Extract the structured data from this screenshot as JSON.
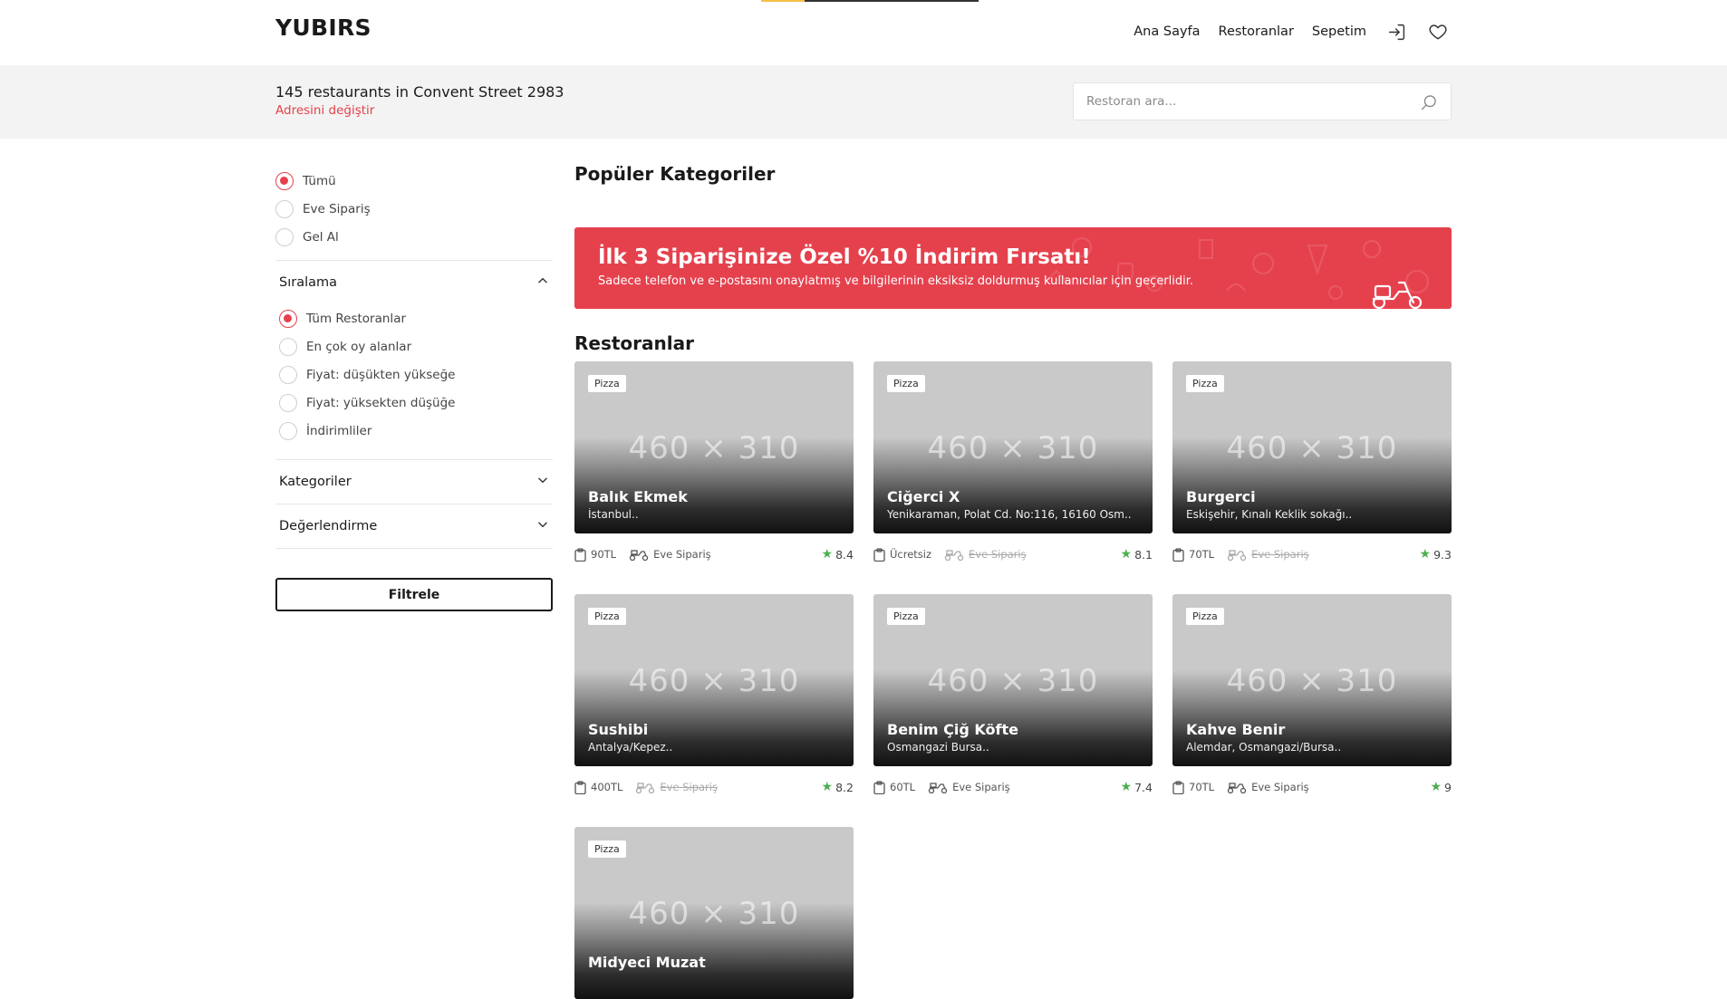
{
  "header": {
    "logo": "YUBIRS",
    "nav": [
      {
        "label": "Ana Sayfa"
      },
      {
        "label": "Restoranlar"
      },
      {
        "label": "Sepetim"
      }
    ],
    "login_icon": "login-icon",
    "favorites_icon": "heart-icon"
  },
  "subbar": {
    "count_text": "145 restaurants in Convent Street 2983",
    "change_link": "Adresini değiştir",
    "search_placeholder": "Restoran ara..."
  },
  "sidebar": {
    "type_options": [
      {
        "label": "Tümü",
        "selected": true
      },
      {
        "label": "Eve Sipariş",
        "selected": false
      },
      {
        "label": "Gel Al",
        "selected": false
      }
    ],
    "sort": {
      "title": "Sıralama",
      "options": [
        {
          "label": "Tüm Restoranlar",
          "selected": true
        },
        {
          "label": "En çok oy alanlar",
          "selected": false
        },
        {
          "label": "Fiyat: düşükten yükseğe",
          "selected": false
        },
        {
          "label": "Fiyat: yüksekten düşüğe",
          "selected": false
        },
        {
          "label": "İndirimliler",
          "selected": false
        }
      ]
    },
    "categories_title": "Kategoriler",
    "rating_title": "Değerlendirme",
    "filter_button": "Filtrele"
  },
  "main": {
    "popular_title": "Popüler Kategoriler",
    "banner": {
      "title": "İlk 3 Siparişinize Özel %10 İndirim Fırsatı!",
      "subtitle": "Sadece telefon ve e-postasını onaylatmış ve bilgilerinin eksiksiz doldurmuş kullanıcılar için geçerlidir."
    },
    "restaurants_title": "Restoranlar",
    "placeholder_text": "460 × 310",
    "restaurants": [
      {
        "tag": "Pizza",
        "name": "Balık Ekmek",
        "address": "İstanbul..",
        "price": "90TL",
        "delivery": "Eve Sipariş",
        "delivery_available": true,
        "rating": "8.4"
      },
      {
        "tag": "Pizza",
        "name": "Ciğerci X",
        "address": "Yenikaraman, Polat Cd. No:116, 16160 Osm..",
        "price": "Ücretsiz",
        "delivery": "Eve Sipariş",
        "delivery_available": false,
        "rating": "8.1"
      },
      {
        "tag": "Pizza",
        "name": "Burgerci",
        "address": "Eskişehir, Kınalı Keklik sokağı..",
        "price": "70TL",
        "delivery": "Eve Sipariş",
        "delivery_available": false,
        "rating": "9.3"
      },
      {
        "tag": "Pizza",
        "name": "Sushibi",
        "address": "Antalya/Kepez..",
        "price": "400TL",
        "delivery": "Eve Sipariş",
        "delivery_available": false,
        "rating": "8.2"
      },
      {
        "tag": "Pizza",
        "name": "Benim Çiğ Köfte",
        "address": "Osmangazi Bursa..",
        "price": "60TL",
        "delivery": "Eve Sipariş",
        "delivery_available": true,
        "rating": "7.4"
      },
      {
        "tag": "Pizza",
        "name": "Kahve Benir",
        "address": "Alemdar, Osmangazi/Bursa..",
        "price": "70TL",
        "delivery": "Eve Sipariş",
        "delivery_available": true,
        "rating": "9"
      },
      {
        "tag": "Pizza",
        "name": "Midyeci Muzat",
        "address": "",
        "price": "",
        "delivery": "",
        "delivery_available": false,
        "rating": ""
      }
    ]
  },
  "colors": {
    "accent": "#e5414d",
    "rating_star": "#4caf50",
    "subbar_bg": "#f3f3f3",
    "progress": "#f5c048"
  }
}
